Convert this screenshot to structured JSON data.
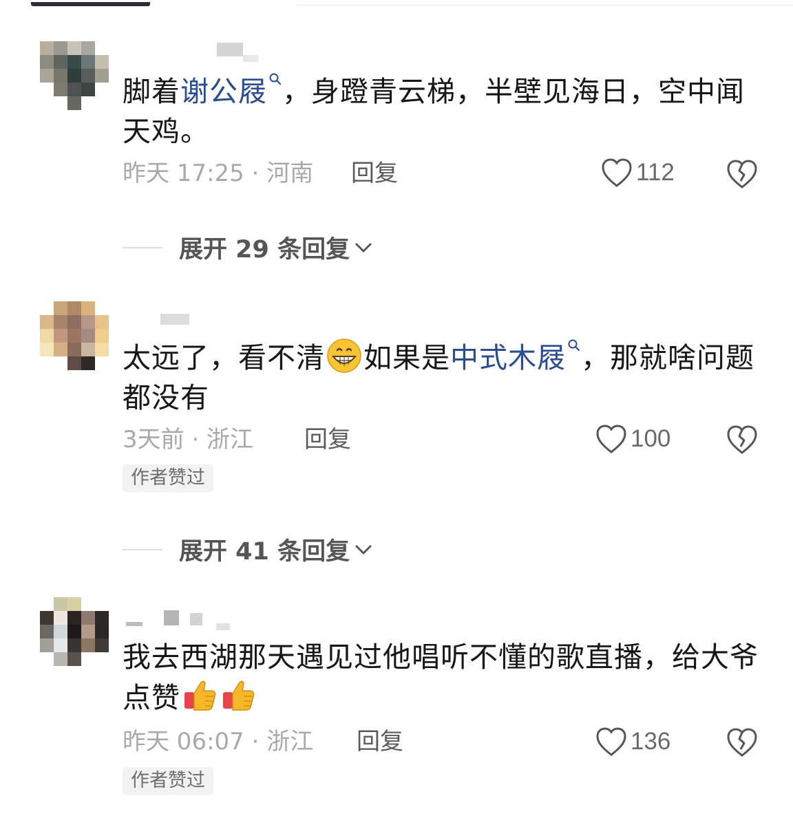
{
  "comments": [
    {
      "text_parts": [
        "脚着",
        "谢公屐",
        "，身蹬青云梯，半壁见海日，空中闻天鸡。"
      ],
      "time_location": "昨天 17:25 · 河南",
      "reply_label": "回复",
      "likes": "112",
      "author_liked": "",
      "expand_label": "展开 29 条回复"
    },
    {
      "text_parts": [
        "太远了，看不清",
        "如果是",
        "中式木屐",
        "，那就啥问题都没有"
      ],
      "time_location": "3天前 · 浙江",
      "reply_label": "回复",
      "likes": "100",
      "author_liked": "作者赞过",
      "expand_label": "展开 41 条回复"
    },
    {
      "text_parts": [
        "我去西湖那天遇见过他唱听不懂的歌直播，给大爷点赞"
      ],
      "time_location": "昨天 06:07 · 浙江",
      "reply_label": "回复",
      "likes": "136",
      "author_liked": "作者赞过"
    }
  ],
  "icons": {
    "link_search": "magnifier-icon",
    "like": "heart-outline-icon",
    "dislike": "broken-heart-icon",
    "grin_emoji": "grinning-emoji",
    "thumbs_up_emoji": "thumbs-up-emoji",
    "expand": "chevron-down-icon"
  },
  "colors": {
    "link": "#2a4d91",
    "meta": "#a9a9a9",
    "text": "#161616"
  }
}
